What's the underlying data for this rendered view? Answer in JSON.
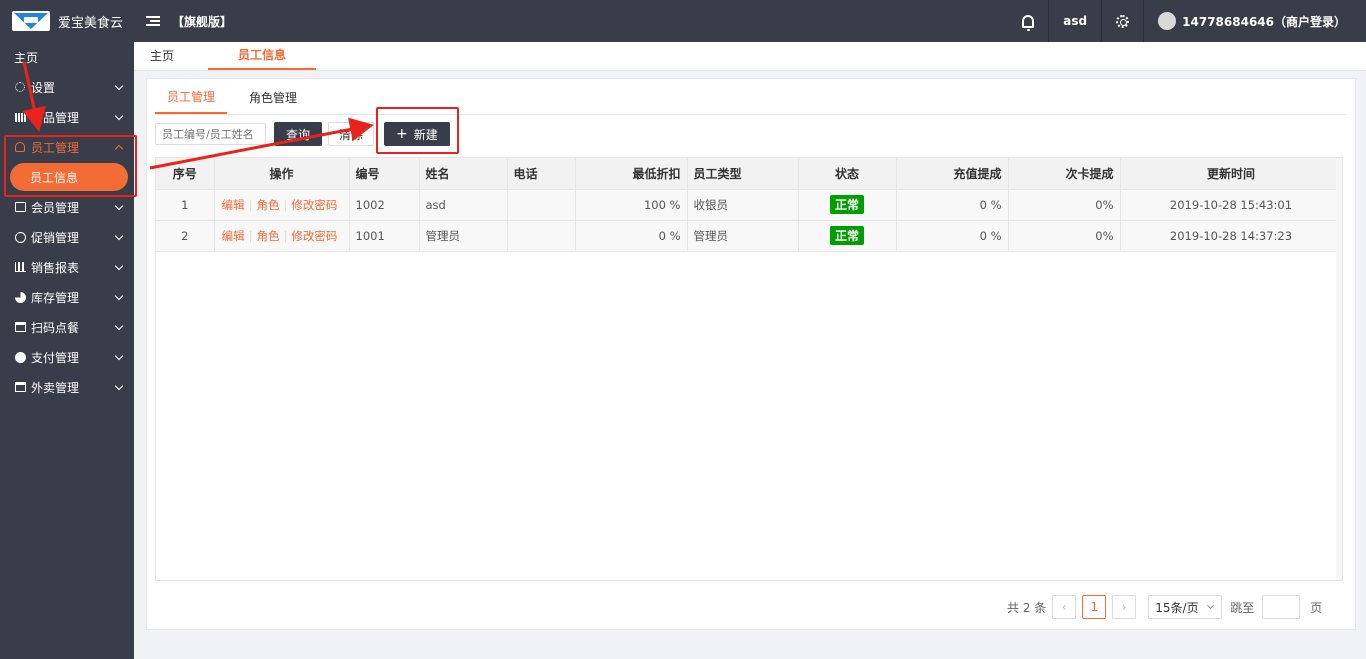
{
  "header": {
    "logo_text": "爱宝美食云",
    "edition": "【旗舰版】",
    "username": "asd",
    "account": "14778684646（商户登录）"
  },
  "sidebar": {
    "home": "主页",
    "items": [
      {
        "label": "设置",
        "icon": "gear-icon"
      },
      {
        "label": "商品管理",
        "icon": "grid-icon"
      },
      {
        "label": "员工管理",
        "icon": "user-icon",
        "expanded": true
      },
      {
        "label": "会员管理",
        "icon": "card-icon"
      },
      {
        "label": "促销管理",
        "icon": "check-circle-icon"
      },
      {
        "label": "销售报表",
        "icon": "bar-chart-icon"
      },
      {
        "label": "库存管理",
        "icon": "pie-chart-icon"
      },
      {
        "label": "扫码点餐",
        "icon": "scan-icon"
      },
      {
        "label": "支付管理",
        "icon": "coin-icon"
      },
      {
        "label": "外卖管理",
        "icon": "delivery-icon"
      }
    ],
    "active_sub": "员工信息"
  },
  "page_tabs": {
    "home": "主页",
    "current": "员工信息"
  },
  "sub_tabs": {
    "employee": "员工管理",
    "role": "角色管理"
  },
  "toolbar": {
    "search_placeholder": "员工编号/员工姓名",
    "query_label": "查询",
    "clear_label": "清除",
    "new_label": "新建"
  },
  "table": {
    "headers": {
      "seq": "序号",
      "op": "操作",
      "code": "编号",
      "name": "姓名",
      "phone": "电话",
      "discount": "最低折扣",
      "type": "员工类型",
      "status": "状态",
      "recharge": "充值提成",
      "card": "次卡提成",
      "updated": "更新时间"
    },
    "op_labels": {
      "edit": "编辑",
      "role": "角色",
      "pwd": "修改密码"
    },
    "rows": [
      {
        "seq": "1",
        "code": "1002",
        "name": "asd",
        "phone": "",
        "discount": "100 %",
        "type": "收银员",
        "status": "正常",
        "recharge": "0 %",
        "card": "0%",
        "updated": "2019-10-28 15:43:01"
      },
      {
        "seq": "2",
        "code": "1001",
        "name": "管理员",
        "phone": "",
        "discount": "0 %",
        "type": "管理员",
        "status": "正常",
        "recharge": "0 %",
        "card": "0%",
        "updated": "2019-10-28 14:37:23"
      }
    ]
  },
  "pager": {
    "total": "共 2 条",
    "prev": "‹",
    "current": "1",
    "next": "›",
    "page_size": "15条/页",
    "jump_label": "跳至",
    "page_suffix": "页"
  },
  "colors": {
    "accent": "#f36c36",
    "sidebar": "#393d49",
    "status_ok": "#009e00",
    "annotation": "#e8231c"
  }
}
